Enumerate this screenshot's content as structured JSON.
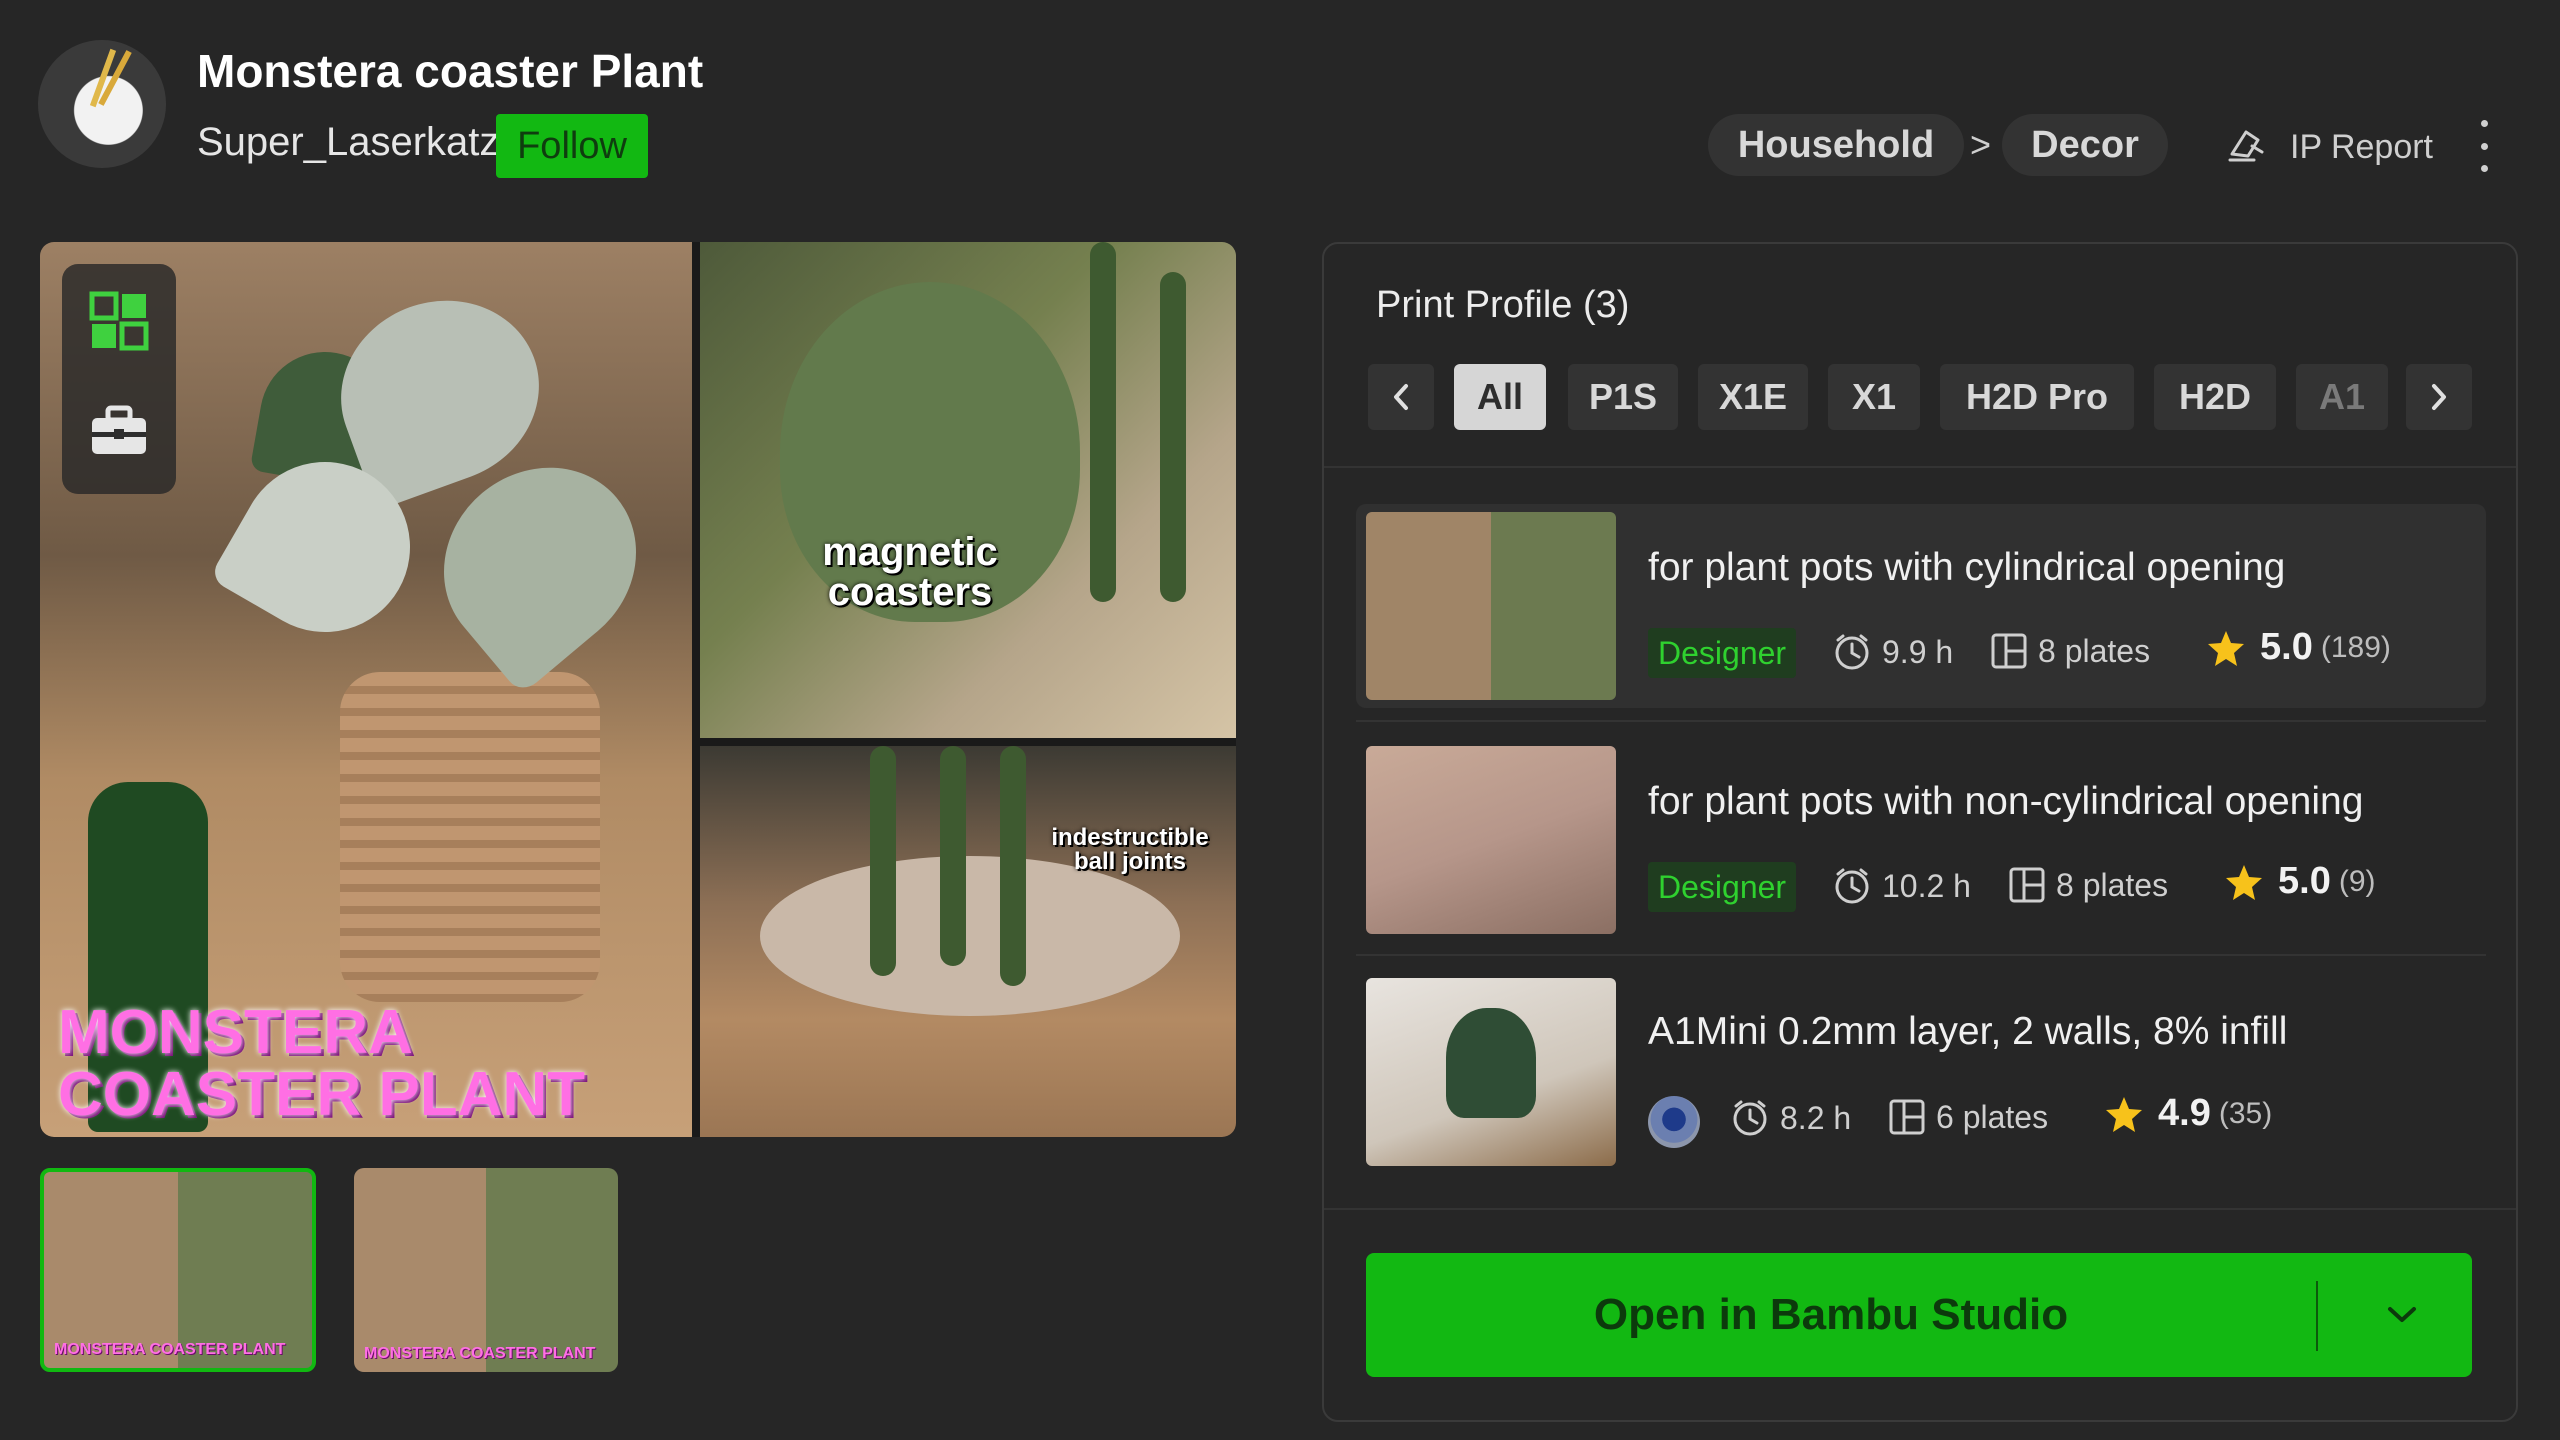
{
  "header": {
    "title": "Monstera coaster Plant",
    "author": "Super_Laserkatz",
    "follow_label": "Follow",
    "breadcrumb": [
      "Household",
      "Decor"
    ],
    "breadcrumb_separator": ">",
    "ip_report_label": "IP Report"
  },
  "gallery": {
    "overlay_magnetic": "magnetic coasters",
    "overlay_ball": "indestructible ball joints",
    "overlay_brand": "MONSTERA COASTER PLANT",
    "thumb_label": "MONSTERA COASTER PLANT",
    "selected_thumb": 1
  },
  "print_profile": {
    "title": "Print Profile (3)",
    "filters": [
      "All",
      "P1S",
      "X1E",
      "X1",
      "H2D Pro",
      "H2D",
      "A1"
    ],
    "active_filter": "All",
    "profiles": [
      {
        "title": "for plant pots with cylindrical opening",
        "badge": "Designer",
        "time": "9.9 h",
        "plates": "8 plates",
        "rating": "5.0",
        "count": "(189)"
      },
      {
        "title": "for plant pots with non-cylindrical opening",
        "badge": "Designer",
        "time": "10.2 h",
        "plates": "8 plates",
        "rating": "5.0",
        "count": "(9)"
      },
      {
        "title": "A1Mini 0.2mm layer, 2 walls, 8% infill",
        "badge": "",
        "time": "8.2 h",
        "plates": "6 plates",
        "rating": "4.9",
        "count": "(35)"
      }
    ],
    "open_button_label": "Open in Bambu Studio"
  },
  "colors": {
    "accent_green": "#12b812",
    "background": "#262626",
    "star": "#f7c21b",
    "brand_pink": "#ff6fe4"
  },
  "icons": [
    "avatar",
    "ip-report-icon",
    "more-icon",
    "model-cube-icon",
    "toolbox-icon",
    "clock-icon",
    "plates-icon",
    "star-icon",
    "chevron-down-icon",
    "chevron-left-icon",
    "chevron-right-icon"
  ]
}
